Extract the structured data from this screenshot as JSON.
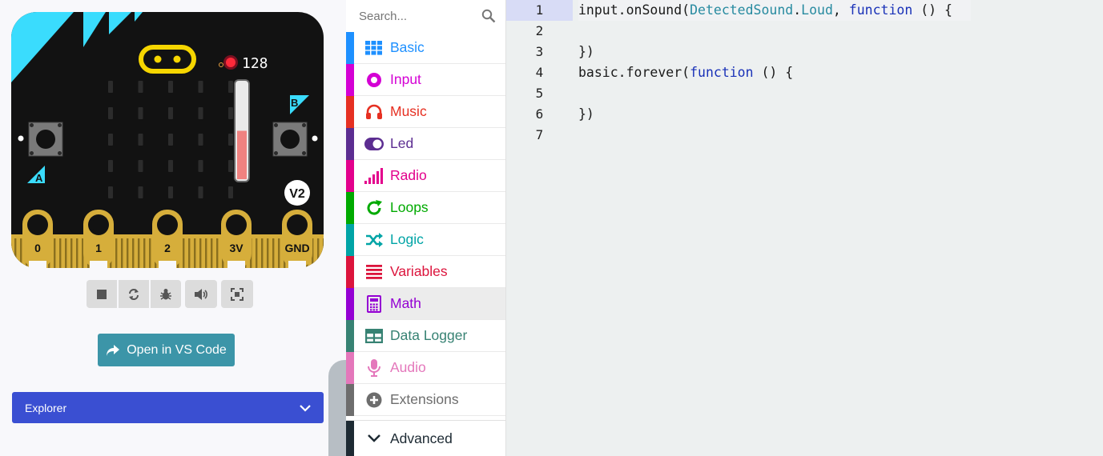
{
  "simulator": {
    "sound_level": "128",
    "sound_level_fraction": 0.5,
    "version_badge": "V2",
    "button_a_label": "A",
    "button_b_label": "B",
    "pins": [
      "0",
      "1",
      "2",
      "3V",
      "GND"
    ],
    "toolbar_icons": [
      "stop-icon",
      "restart-icon",
      "debug-icon",
      "mute-icon",
      "fullscreen-icon"
    ]
  },
  "vscode_button": {
    "label": "Open in VS Code"
  },
  "explorer": {
    "label": "Explorer"
  },
  "toolbox": {
    "search_placeholder": "Search...",
    "categories": [
      {
        "label": "Basic",
        "color": "#1e90ff"
      },
      {
        "label": "Input",
        "color": "#d400d4"
      },
      {
        "label": "Music",
        "color": "#e63022"
      },
      {
        "label": "Led",
        "color": "#5c2d91"
      },
      {
        "label": "Radio",
        "color": "#e3008c"
      },
      {
        "label": "Loops",
        "color": "#00aa00"
      },
      {
        "label": "Logic",
        "color": "#00a4a6"
      },
      {
        "label": "Variables",
        "color": "#dc143c"
      },
      {
        "label": "Math",
        "color": "#9400d3"
      },
      {
        "label": "Data Logger",
        "color": "#378273"
      },
      {
        "label": "Audio",
        "color": "#e477bb"
      },
      {
        "label": "Extensions",
        "color": "#6d6d6d"
      }
    ],
    "advanced_label": "Advanced"
  },
  "editor": {
    "lines": [
      {
        "number": "1",
        "tokens": [
          [
            "input.onSound(",
            ""
          ],
          [
            "DetectedSound",
            "tp"
          ],
          [
            ".",
            ""
          ],
          [
            "Loud",
            "tp"
          ],
          [
            ", ",
            ""
          ],
          [
            "function",
            "kw"
          ],
          [
            " () {",
            ""
          ]
        ]
      },
      {
        "number": "2",
        "tokens": []
      },
      {
        "number": "3",
        "tokens": [
          [
            "})",
            ""
          ]
        ]
      },
      {
        "number": "4",
        "tokens": [
          [
            "basic.forever(",
            ""
          ],
          [
            "function",
            "kw"
          ],
          [
            " () {",
            ""
          ]
        ]
      },
      {
        "number": "5",
        "tokens": []
      },
      {
        "number": "6",
        "tokens": [
          [
            "})",
            ""
          ]
        ]
      },
      {
        "number": "7",
        "tokens": []
      }
    ]
  }
}
